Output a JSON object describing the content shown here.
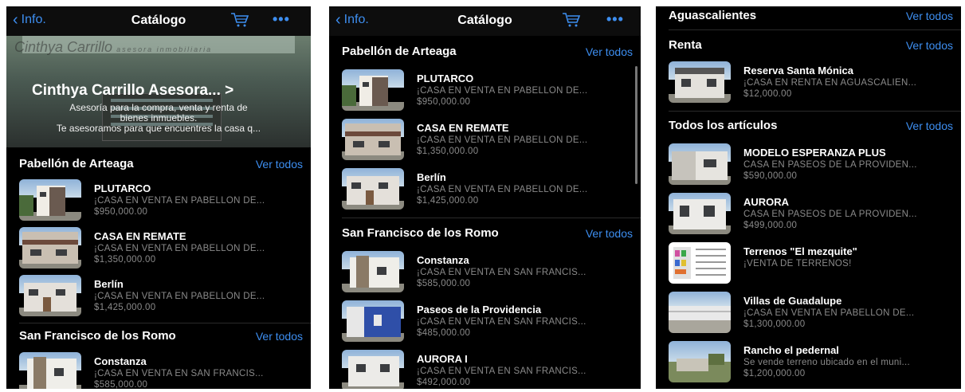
{
  "screen1": {
    "back_label": "Info.",
    "title": "Catálogo",
    "more_label": "•••",
    "hero": {
      "sign_text": "Cinthya Carrillo",
      "sign_sub": "asesora inmobiliaria",
      "name": "Cinthya Carrillo Asesora... >",
      "line1": "Asesoría para la compra, venta y renta de",
      "line2": "bienes inmuebles.",
      "line3": "Te asesoramos para que encuentres la casa q..."
    },
    "sections": [
      {
        "name": "Pabellón de Arteaga",
        "link": "Ver todos",
        "items": [
          {
            "title": "PLUTARCO",
            "desc": "¡CASA EN VENTA EN PABELLÓN DE...",
            "price": "$950,000.00"
          },
          {
            "title": "CASA EN REMATE",
            "desc": "¡CASA EN VENTA EN PABELLÓN DE...",
            "price": "$1,350,000.00"
          },
          {
            "title": "Berlín",
            "desc": "¡CASA EN VENTA EN PABELLÓN DE...",
            "price": "$1,425,000.00"
          }
        ]
      },
      {
        "name": "San Francisco de los Romo",
        "link": "Ver todos",
        "items": [
          {
            "title": "Constanza",
            "desc": "¡CASA EN VENTA EN SAN FRANCIS...",
            "price": "$585,000.00"
          }
        ]
      }
    ]
  },
  "screen2": {
    "back_label": "Info.",
    "title": "Catálogo",
    "more_label": "•••",
    "sections": [
      {
        "name": "Pabellón de Arteaga",
        "link": "Ver todos",
        "items": [
          {
            "title": "PLUTARCO",
            "desc": "¡CASA EN VENTA EN PABELLÓN DE...",
            "price": "$950,000.00"
          },
          {
            "title": "CASA EN REMATE",
            "desc": "¡CASA EN VENTA EN PABELLÓN DE...",
            "price": "$1,350,000.00"
          },
          {
            "title": "Berlín",
            "desc": "¡CASA EN VENTA EN PABELLÓN DE...",
            "price": "$1,425,000.00"
          }
        ]
      },
      {
        "name": "San Francisco de los Romo",
        "link": "Ver todos",
        "items": [
          {
            "title": "Constanza",
            "desc": "¡CASA EN VENTA EN SAN FRANCIS...",
            "price": "$585,000.00"
          },
          {
            "title": "Paseos de la Providencia",
            "desc": "¡CASA EN VENTA EN SAN FRANCIS...",
            "price": "$485,000.00"
          },
          {
            "title": "AURORA I",
            "desc": "¡CASA EN VENTA EN SAN FRANCIS...",
            "price": "$492,000.00"
          }
        ]
      }
    ]
  },
  "screen3": {
    "sections": [
      {
        "name": "Aguascalientes",
        "link": "Ver todos",
        "items": []
      },
      {
        "name": "Renta",
        "link": "Ver todos",
        "items": [
          {
            "title": "Reserva Santa Mónica",
            "desc": "¡CASA EN RENTA EN AGUASCALIEN...",
            "price": "$12,000.00"
          }
        ]
      },
      {
        "name": "Todos los artículos",
        "link": "Ver todos",
        "items": [
          {
            "title": "MODELO ESPERANZA PLUS",
            "desc": "CASA EN PASEOS DE LA PROVIDEN...",
            "price": "$590,000.00"
          },
          {
            "title": "AURORA",
            "desc": "CASA EN PASEOS DE LA PROVIDEN...",
            "price": "$499,000.00"
          },
          {
            "title": "Terrenos \"El mezquite\"",
            "desc": "¡VENTA DE TERRENOS!",
            "price": ""
          },
          {
            "title": "Villas de Guadalupe",
            "desc": "¡CASA EN VENTA EN PABELLÓN DE...",
            "price": "$1,300,000.00"
          },
          {
            "title": "Rancho el pedernal",
            "desc": "Se vende terreno ubicado en el muni...",
            "price": "$1,200,000.00"
          }
        ]
      }
    ]
  },
  "colors": {
    "accent": "#3d8ef0",
    "background": "#000000",
    "secondary_text": "#8a8a8a"
  },
  "icons": [
    "back-chevron-icon",
    "cart-icon",
    "more-icon"
  ]
}
